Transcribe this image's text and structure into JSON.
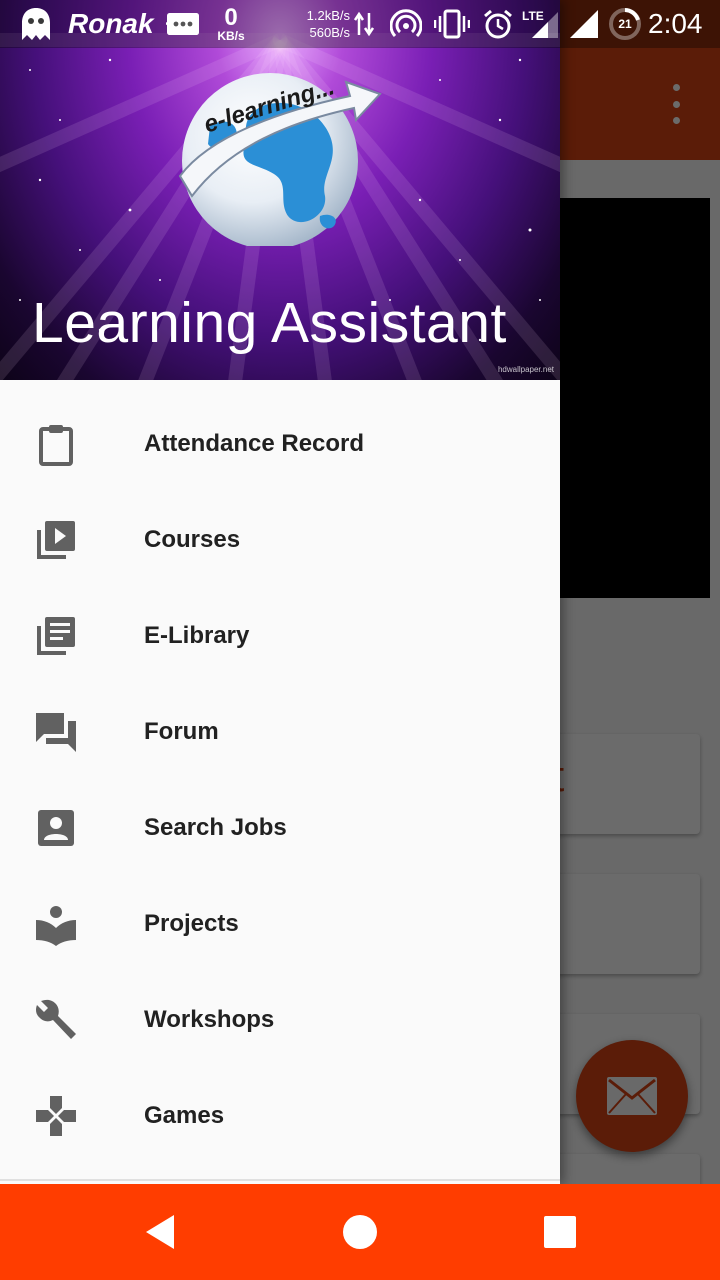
{
  "status_bar": {
    "carrier": "Ronak",
    "net_speed_value": "0",
    "net_speed_unit": "KB/s",
    "upload_rate": "1.2kB/s",
    "download_rate": "560B/s",
    "network_type": "LTE",
    "battery_level": "21",
    "time": "2:04"
  },
  "drawer": {
    "header_title": "Learning Assistant",
    "logo_text": "e-learning...",
    "image_credit": "hdwallpaper.net",
    "items": [
      {
        "label": "Attendance Record",
        "icon": "clipboard-icon"
      },
      {
        "label": "Courses",
        "icon": "video-library-icon"
      },
      {
        "label": "E-Library",
        "icon": "library-books-icon"
      },
      {
        "label": "Forum",
        "icon": "forum-icon"
      },
      {
        "label": "Search Jobs",
        "icon": "account-box-icon"
      },
      {
        "label": "Projects",
        "icon": "local-library-icon"
      },
      {
        "label": "Workshops",
        "icon": "wrench-icon"
      },
      {
        "label": "Games",
        "icon": "games-icon"
      }
    ]
  },
  "background_app": {
    "card_text_fragment": "t"
  },
  "colors": {
    "primary": "#d84315",
    "nav_bar": "#ff3d00",
    "drawer_bg": "#fafafa",
    "icon_grey": "#616161",
    "text": "#212121"
  }
}
